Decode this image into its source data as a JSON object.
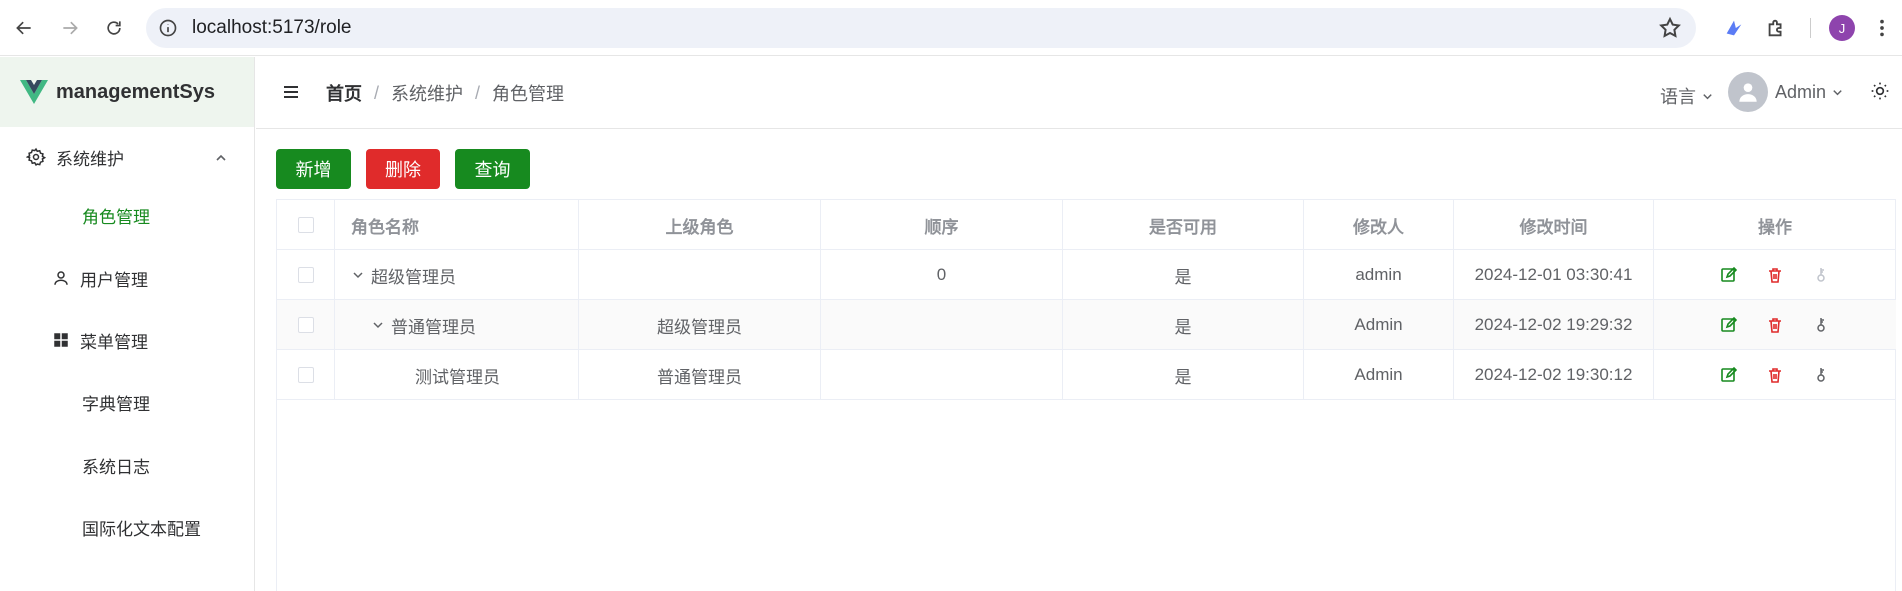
{
  "browser": {
    "url": "localhost:5173/role",
    "profile_initial": "J"
  },
  "sidebar": {
    "app_name": "managementSys",
    "group": {
      "label": "系统维护",
      "icon": "gear-icon"
    },
    "items": [
      {
        "label": "角色管理",
        "active": true
      },
      {
        "label": "用户管理",
        "icon": "user-icon"
      },
      {
        "label": "菜单管理",
        "icon": "grid-icon"
      },
      {
        "label": "字典管理"
      },
      {
        "label": "系统日志"
      },
      {
        "label": "国际化文本配置"
      }
    ]
  },
  "header": {
    "breadcrumb": {
      "home": "首页",
      "level1": "系统维护",
      "level2": "角色管理",
      "separator": "/"
    },
    "language_label": "语言",
    "user_name": "Admin"
  },
  "toolbar": {
    "add_label": "新增",
    "delete_label": "删除",
    "query_label": "查询"
  },
  "table": {
    "columns": {
      "name": "角色名称",
      "parent": "上级角色",
      "order": "顺序",
      "enabled": "是否可用",
      "modifier": "修改人",
      "modified_time": "修改时间",
      "actions": "操作"
    },
    "rows": [
      {
        "name": "超级管理员",
        "parent": "",
        "order": "0",
        "enabled": "是",
        "modifier": "admin",
        "modified_time": "2024-12-01 03:30:41"
      },
      {
        "name": "普通管理员",
        "parent": "超级管理员",
        "order": "",
        "enabled": "是",
        "modifier": "Admin",
        "modified_time": "2024-12-02 19:29:32"
      },
      {
        "name": "测试管理员",
        "parent": "普通管理员",
        "order": "",
        "enabled": "是",
        "modifier": "Admin",
        "modified_time": "2024-12-02 19:30:12"
      }
    ]
  },
  "colors": {
    "primary": "#178a1f",
    "danger": "#e02b2b",
    "edit_icon": "#178a1f",
    "delete_icon": "#e02b2b",
    "key_icon": "#606266"
  }
}
